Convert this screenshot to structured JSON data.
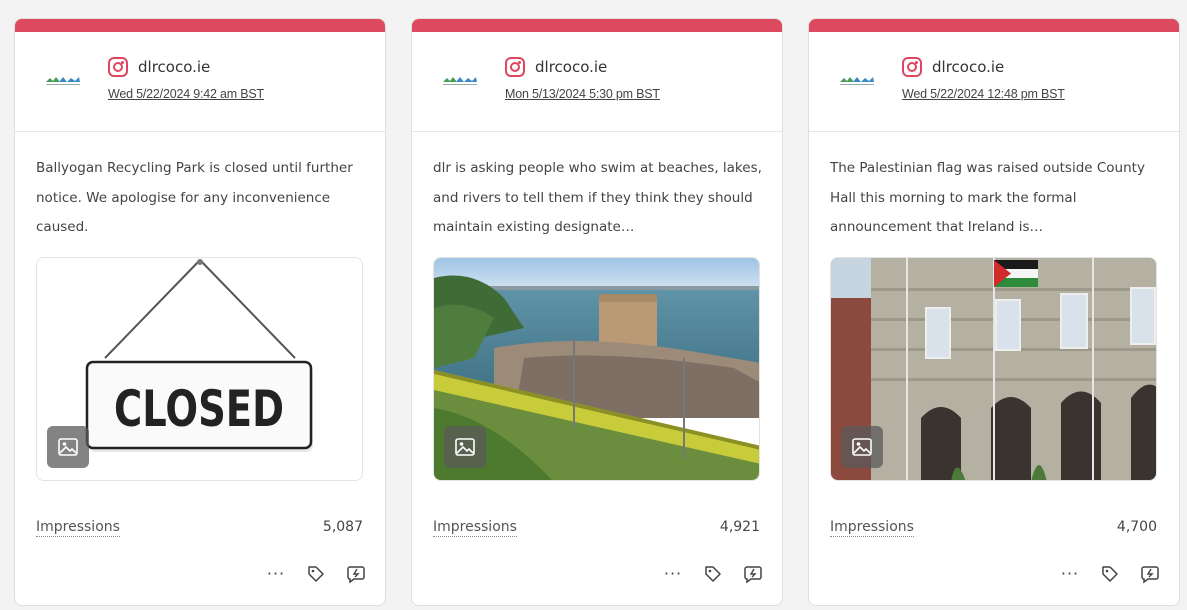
{
  "posts": [
    {
      "account": "dlrcoco.ie",
      "date": "Wed 5/22/2024 9:42 am BST",
      "caption": "Ballyogan Recycling Park is closed until further notice. We apologise for any inconvenience caused.",
      "image_alt": "closed-sign",
      "sign_text": "CLOSED",
      "metric_label": "Impressions",
      "metric_value": "5,087"
    },
    {
      "account": "dlrcoco.ie",
      "date": "Mon 5/13/2024 5:30 pm BST",
      "caption": "dlr is asking people who swim at beaches, lakes, and rivers to tell them if they think they should maintain existing designate…",
      "image_alt": "coastal-tower-and-train",
      "metric_label": "Impressions",
      "metric_value": "4,921"
    },
    {
      "account": "dlrcoco.ie",
      "date": "Wed 5/22/2024 12:48 pm BST",
      "caption": "The Palestinian flag was raised outside County Hall this morning to mark the formal announcement that Ireland is…",
      "image_alt": "county-hall-flag",
      "metric_label": "Impressions",
      "metric_value": "4,700"
    }
  ],
  "icons": {
    "platform": "instagram-icon",
    "more": "more-dots-icon",
    "tag": "tag-icon",
    "reply": "reply-icon",
    "image_badge": "image-icon"
  },
  "colors": {
    "topbar": "#dd4a5f",
    "instagram": "#e0455e"
  },
  "actions_text": {
    "more": "···"
  }
}
